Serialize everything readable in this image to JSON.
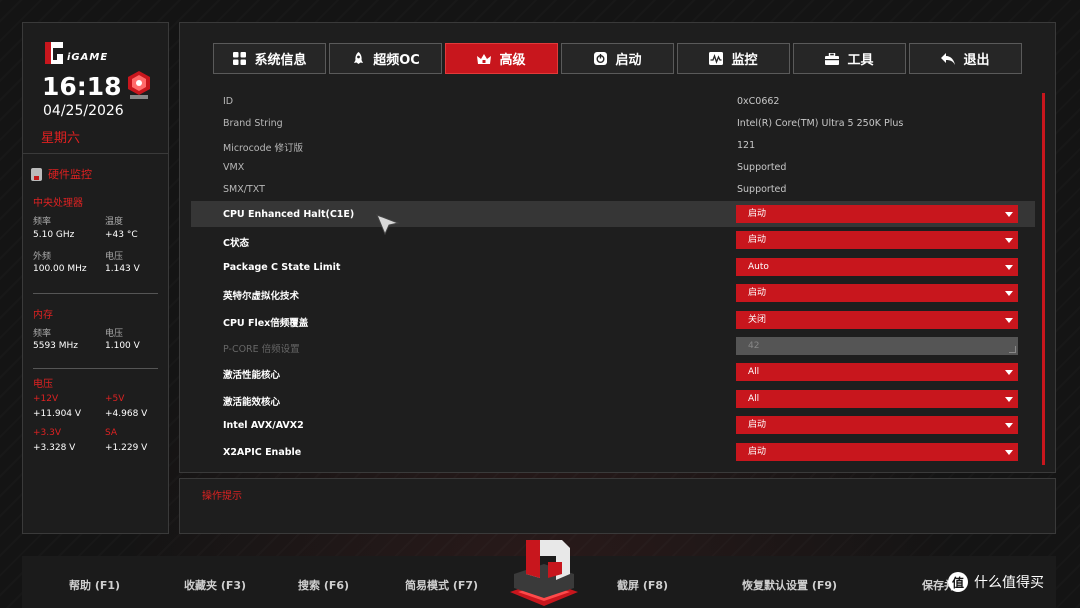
{
  "brand": "iGAME",
  "time": "16:18",
  "date": "04/25/2026",
  "weekday": "星期六",
  "monitor": {
    "title": "硬件监控",
    "cpu": {
      "title": "中央处理器",
      "freq_label": "频率",
      "freq": "5.10 GHz",
      "temp_label": "温度",
      "temp": "+43 °C",
      "bclk_label": "外频",
      "bclk": "100.00 MHz",
      "volt_label": "电压",
      "volt": "1.143 V"
    },
    "memory": {
      "title": "内存",
      "freq_label": "频率",
      "freq": "5593 MHz",
      "volt_label": "电压",
      "volt": "1.100 V"
    },
    "voltage": {
      "title": "电压",
      "v12_label": "+12V",
      "v12": "+11.904 V",
      "v5_label": "+5V",
      "v5": "+4.968 V",
      "v33_label": "+3.3V",
      "v33": "+3.328 V",
      "sa_label": "SA",
      "sa": "+1.229 V"
    }
  },
  "tabs": [
    {
      "label": "系统信息",
      "icon": "grid-icon"
    },
    {
      "label": "超频OC",
      "icon": "rocket-icon"
    },
    {
      "label": "高级",
      "icon": "crown-icon",
      "active": true
    },
    {
      "label": "启动",
      "icon": "power-icon"
    },
    {
      "label": "监控",
      "icon": "monitor-chart-icon"
    },
    {
      "label": "工具",
      "icon": "toolbox-icon"
    },
    {
      "label": "退出",
      "icon": "back-arrow-icon"
    }
  ],
  "info": [
    {
      "label": "ID",
      "value": "0xC0662"
    },
    {
      "label": "Brand String",
      "value": "Intel(R) Core(TM) Ultra 5 250K Plus"
    },
    {
      "label": "Microcode 修订版",
      "value": "121"
    },
    {
      "label": "VMX",
      "value": "Supported"
    },
    {
      "label": "SMX/TXT",
      "value": "Supported"
    }
  ],
  "settings": [
    {
      "label": "CPU Enhanced Halt(C1E)",
      "value": "启动"
    },
    {
      "label": "C状态",
      "value": "启动"
    },
    {
      "label": "Package C State Limit",
      "value": "Auto"
    },
    {
      "label": "英特尔虚拟化技术",
      "value": "启动"
    },
    {
      "label": "CPU Flex倍频覆盖",
      "value": "关闭"
    },
    {
      "label": "P-CORE 倍频设置",
      "value": "42"
    },
    {
      "label": "激活性能核心",
      "value": "All"
    },
    {
      "label": "激活能效核心",
      "value": "All"
    },
    {
      "label": "Intel AVX/AVX2",
      "value": "启动"
    },
    {
      "label": "X2APIC Enable",
      "value": "启动"
    }
  ],
  "hint_title": "操作提示",
  "footer": {
    "help": "帮助 (F1)",
    "favorites": "收藏夹 (F3)",
    "search": "搜索 (F6)",
    "easy_mode": "简易模式 (F7)",
    "screenshot": "截屏 (F8)",
    "defaults": "恢复默认设置 (F9)",
    "save": "保存并"
  },
  "watermark": "什么值得买",
  "colors": {
    "accent": "#c8161d",
    "background": "#141414",
    "panel": "#1e1e1e"
  }
}
